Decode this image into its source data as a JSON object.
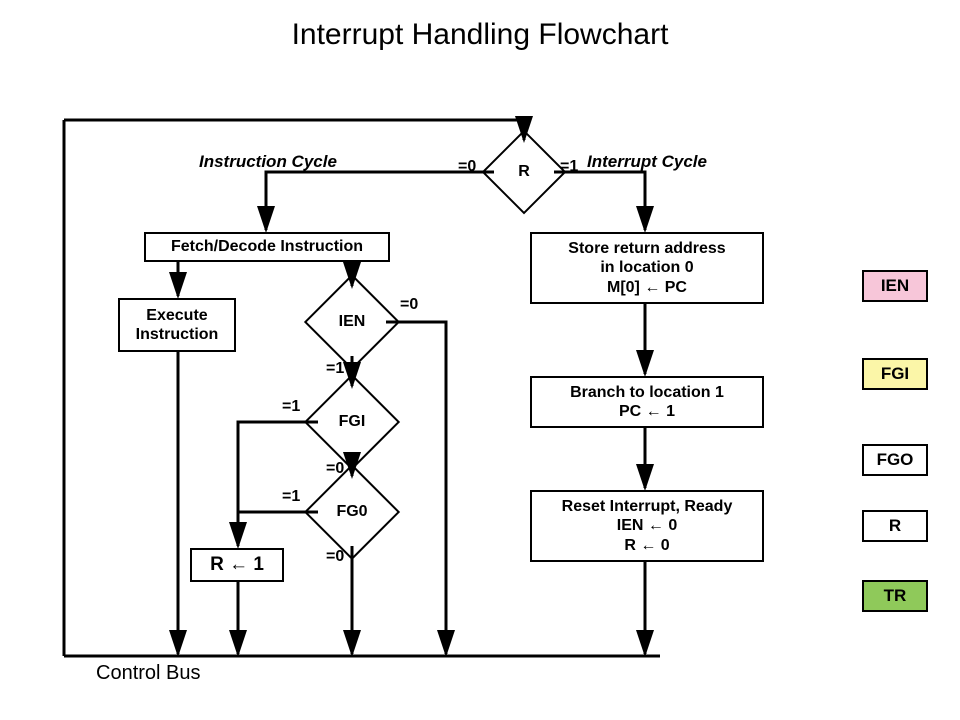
{
  "title": "Interrupt Handling Flowchart",
  "sections": {
    "instruction_cycle": "Instruction Cycle",
    "interrupt_cycle": "Interrupt Cycle"
  },
  "decisions": {
    "R": "R",
    "IEN": "IEN",
    "FGI": "FGI",
    "FG0": "FG0"
  },
  "edge_labels": {
    "eq0": "=0",
    "eq1": "=1"
  },
  "boxes": {
    "fetch_decode": "Fetch/Decode Instruction",
    "execute": "Execute\nInstruction",
    "store_return": "Store return address\nin location 0\nM[0] ← PC",
    "branch": "Branch to location 1\nPC ← 1",
    "reset": "Reset Interrupt, Ready\nIEN ← 0\nR ← 0",
    "r_set": "R ← 1"
  },
  "control_bus": "Control Bus",
  "legend": {
    "IEN": "IEN",
    "FGI": "FGI",
    "FGO": "FGO",
    "R": "R",
    "TR": "TR"
  },
  "colors": {
    "IEN": "#f7c6d9",
    "FGI": "#fbf6a8",
    "FGO": "#ffffff",
    "R": "#ffffff",
    "TR": "#8fc95a"
  }
}
